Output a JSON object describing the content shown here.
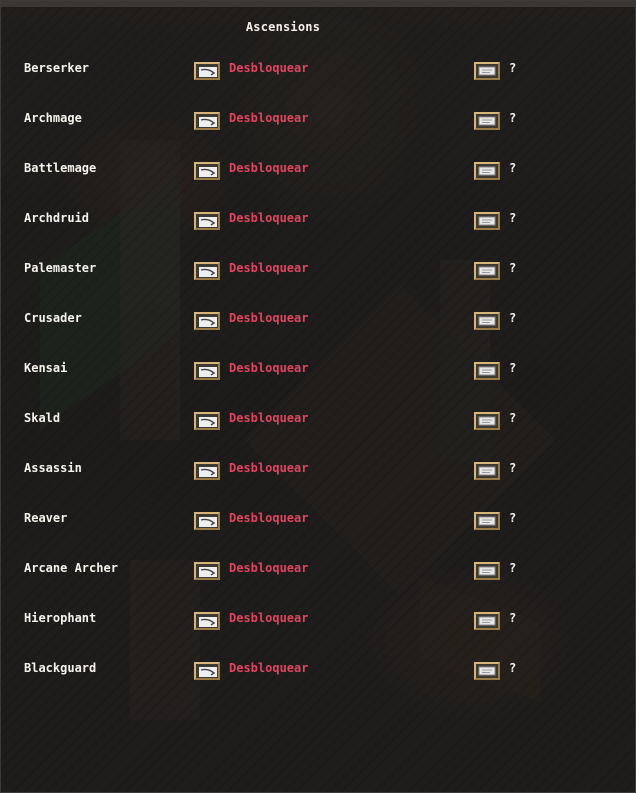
{
  "gump": {
    "title": "Ascensions",
    "unlock_label": "Desbloquear",
    "info_label": "?",
    "classes": [
      {
        "name": "Berserker"
      },
      {
        "name": "Archmage"
      },
      {
        "name": "Battlemage"
      },
      {
        "name": "Archdruid"
      },
      {
        "name": "Palemaster"
      },
      {
        "name": "Crusader"
      },
      {
        "name": "Kensai"
      },
      {
        "name": "Skald"
      },
      {
        "name": "Assassin"
      },
      {
        "name": "Reaver"
      },
      {
        "name": "Arcane Archer"
      },
      {
        "name": "Hierophant"
      },
      {
        "name": "Blackguard"
      }
    ]
  },
  "colors": {
    "label_text": "#f6f3ec",
    "unlock_text": "#e0455f",
    "button_border": "#9a7a45"
  },
  "icons": {
    "unlock_button": "scroll-arrow-icon",
    "info_button": "paper-icon"
  }
}
